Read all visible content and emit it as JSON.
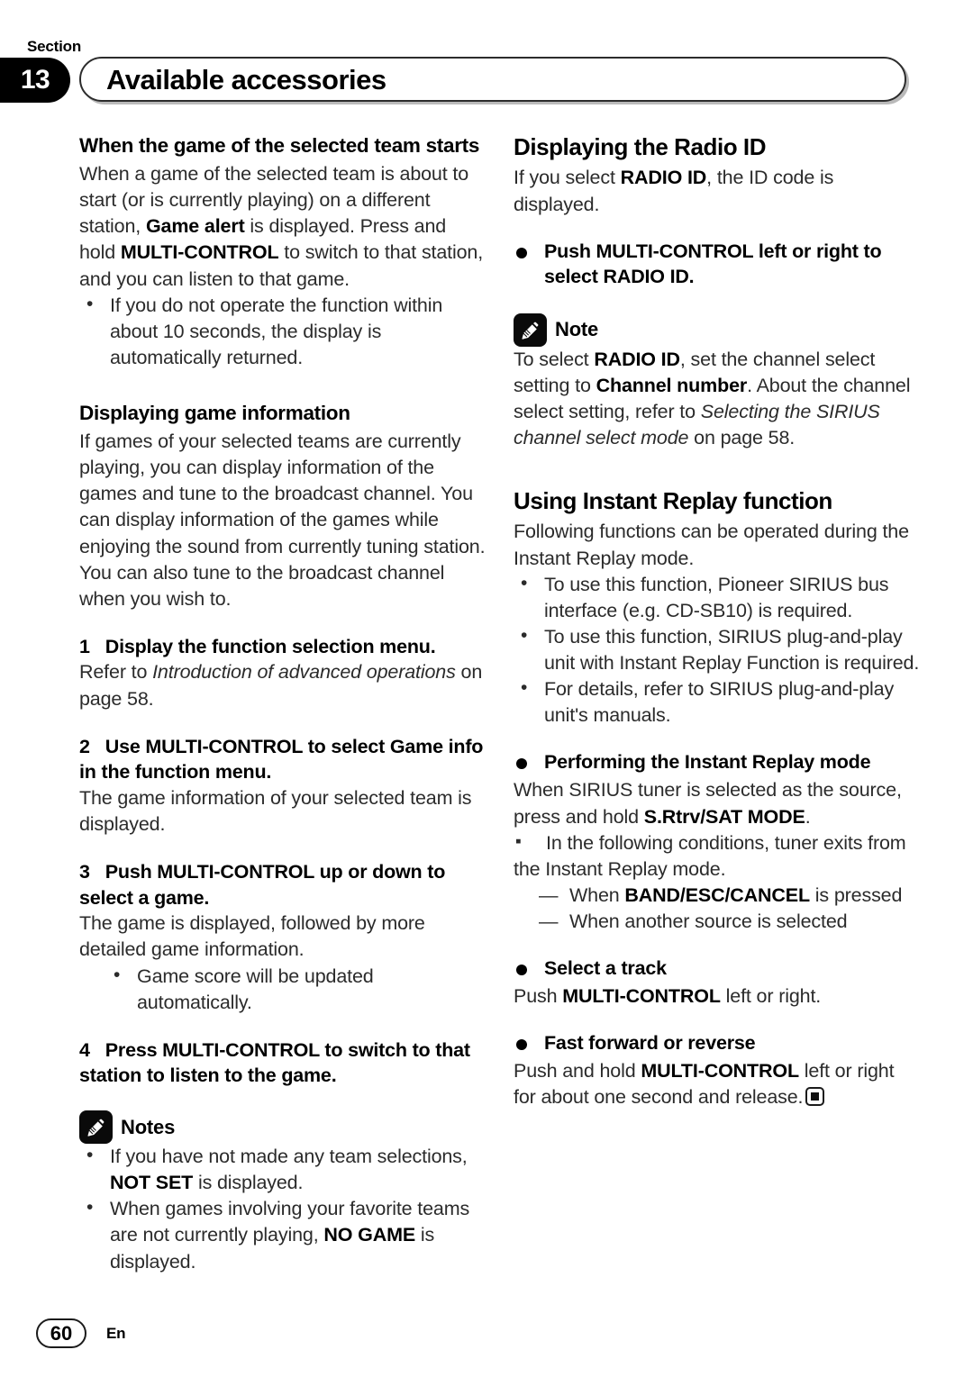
{
  "header": {
    "section_word": "Section",
    "section_number": "13",
    "title": "Available accessories"
  },
  "footer": {
    "page_number": "60",
    "language": "En"
  },
  "left_column": {
    "heading1": "When the game of the selected team starts",
    "para1_parts": [
      {
        "t": "When a game of the selected team is about to start (or is currently playing) on a different station, ",
        "s": "normal"
      },
      {
        "t": "Game alert",
        "s": "bold"
      },
      {
        "t": " is displayed. Press and hold ",
        "s": "normal"
      },
      {
        "t": "MULTI-CONTROL",
        "s": "bold"
      },
      {
        "t": " to switch to that station, and you can listen to that game.",
        "s": "normal"
      }
    ],
    "bullet1": "If you do not operate the function within about 10 seconds, the display is automatically returned.",
    "heading2": "Displaying game information",
    "para2": "If games of your selected teams are currently playing, you can display information of the games and tune to the broadcast channel. You can display information of the games while enjoying the sound from currently tuning station. You can also tune to the broadcast channel when you wish to.",
    "step1_num": "1",
    "step1_text": "Display the function selection menu.",
    "step1_body_parts": [
      {
        "t": "Refer to ",
        "s": "normal"
      },
      {
        "t": "Introduction of advanced operations",
        "s": "italic"
      },
      {
        "t": " on page 58.",
        "s": "normal"
      }
    ],
    "step2_num": "2",
    "step2_text": "Use MULTI-CONTROL to select Game info in the function menu.",
    "step2_body": "The game information of your selected team is displayed.",
    "step3_num": "3",
    "step3_text": "Push MULTI-CONTROL up or down to select a game.",
    "step3_body": "The game is displayed, followed by more detailed game information.",
    "step3_bullet": "Game score will be updated automatically.",
    "step4_num": "4",
    "step4_text": "Press MULTI-CONTROL to switch to that station to listen to the game.",
    "notes_label": "Notes",
    "notes_icon": "pencil-icon",
    "note_bullet1_parts": [
      {
        "t": "If you have not made any team selections, ",
        "s": "normal"
      },
      {
        "t": "NOT SET",
        "s": "bold"
      },
      {
        "t": " is displayed.",
        "s": "normal"
      }
    ],
    "note_bullet2_parts": [
      {
        "t": "When games involving your favorite teams are not currently playing, ",
        "s": "normal"
      },
      {
        "t": "NO GAME",
        "s": "bold"
      },
      {
        "t": " is displayed.",
        "s": "normal"
      }
    ]
  },
  "right_column": {
    "heading1": "Displaying the Radio ID",
    "para1_parts": [
      {
        "t": "If you select ",
        "s": "normal"
      },
      {
        "t": "RADIO ID",
        "s": "bold"
      },
      {
        "t": ", the ID code is displayed.",
        "s": "normal"
      }
    ],
    "bullet_head1": "Push MULTI-CONTROL left or right to select RADIO ID.",
    "note_label": "Note",
    "note_icon": "pencil-icon",
    "note_body_parts": [
      {
        "t": "To select ",
        "s": "normal"
      },
      {
        "t": "RADIO ID",
        "s": "bold"
      },
      {
        "t": ", set the channel select setting to ",
        "s": "normal"
      },
      {
        "t": "Channel number",
        "s": "bold"
      },
      {
        "t": ". About the channel select setting, refer to ",
        "s": "normal"
      },
      {
        "t": "Selecting the SIRIUS channel select mode",
        "s": "italic"
      },
      {
        "t": " on page 58.",
        "s": "normal"
      }
    ],
    "heading2": "Using Instant Replay function",
    "para2": "Following functions can be operated during the Instant Replay mode.",
    "bullets2": [
      "To use this function, Pioneer SIRIUS bus interface (e.g. CD-SB10) is required.",
      "To use this function, SIRIUS plug-and-play unit with Instant Replay Function is required.",
      "For details, refer to SIRIUS plug-and-play unit's manuals."
    ],
    "bullet_head2": "Performing the Instant Replay mode",
    "para3_parts": [
      {
        "t": "When SIRIUS tuner is selected as the source, press and hold ",
        "s": "normal"
      },
      {
        "t": "S.Rtrv/SAT MODE",
        "s": "bold"
      },
      {
        "t": ".",
        "s": "normal"
      }
    ],
    "square_bullet": "In the following conditions, tuner exits from the Instant Replay mode.",
    "dash_items_parts": [
      [
        {
          "t": "When ",
          "s": "normal"
        },
        {
          "t": "BAND/ESC/CANCEL",
          "s": "bold"
        },
        {
          "t": " is pressed",
          "s": "normal"
        }
      ],
      [
        {
          "t": "When another source is selected",
          "s": "normal"
        }
      ]
    ],
    "bullet_head3": "Select a track",
    "para4_parts": [
      {
        "t": "Push ",
        "s": "normal"
      },
      {
        "t": "MULTI-CONTROL",
        "s": "bold"
      },
      {
        "t": " left or right.",
        "s": "normal"
      }
    ],
    "bullet_head4": "Fast forward or reverse",
    "para5_parts": [
      {
        "t": "Push and hold ",
        "s": "normal"
      },
      {
        "t": "MULTI-CONTROL",
        "s": "bold"
      },
      {
        "t": " left or right for about one second and release.",
        "s": "normal"
      }
    ],
    "end_marker": "end-of-section-marker"
  }
}
